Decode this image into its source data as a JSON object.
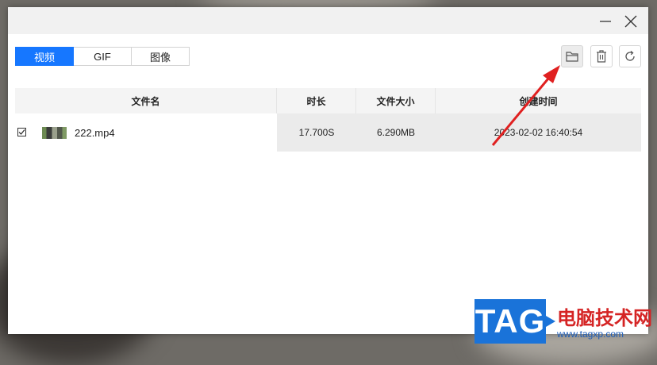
{
  "window": {
    "controls": {
      "minimize_icon": "minimize-icon",
      "close_icon": "close-icon"
    }
  },
  "tabs": [
    {
      "label": "视频",
      "active": true
    },
    {
      "label": "GIF",
      "active": false
    },
    {
      "label": "图像",
      "active": false
    }
  ],
  "toolbar": {
    "open_folder_icon": "folder-icon",
    "delete_icon": "trash-icon",
    "refresh_icon": "refresh-icon"
  },
  "table": {
    "headers": [
      "文件名",
      "时长",
      "文件大小",
      "创建时间"
    ],
    "rows": [
      {
        "checked": true,
        "thumbnail_icon": "video-thumbnail",
        "name": "222.mp4",
        "duration": "17.700S",
        "size": "6.290MB",
        "created": "2023-02-02 16:40:54"
      }
    ]
  },
  "colors": {
    "accent": "#1677ff",
    "annotation_arrow": "#e02020",
    "watermark_blue": "#1a73d9",
    "watermark_red": "#d52424"
  },
  "watermark": {
    "tag": "TAG",
    "site_name": "电脑技术网",
    "url": "www.tagxp.com"
  }
}
